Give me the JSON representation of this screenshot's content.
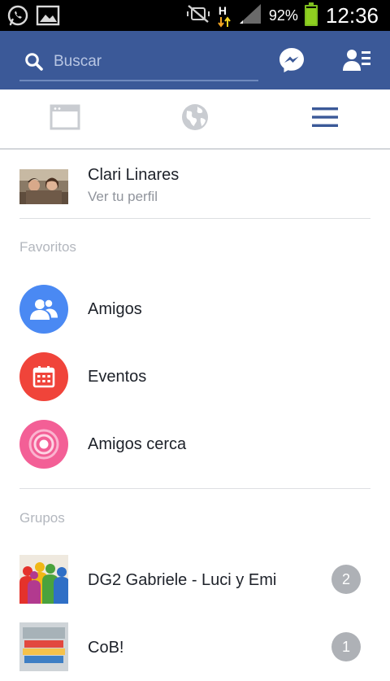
{
  "status_bar": {
    "battery_percent": "92%",
    "battery_level": 0.92,
    "time": "12:36",
    "network_type": "H",
    "icons": [
      "whatsapp-icon",
      "gallery-icon",
      "mute-icon",
      "data-arrows-icon",
      "signal-icon",
      "battery-icon"
    ]
  },
  "header": {
    "search_placeholder": "Buscar",
    "icons": [
      "search-icon",
      "messenger-icon",
      "friend-requests-icon"
    ]
  },
  "tabs": [
    {
      "name": "news-feed",
      "icon": "news-feed-icon",
      "active": false
    },
    {
      "name": "notifications",
      "icon": "globe-icon",
      "active": false
    },
    {
      "name": "more",
      "icon": "hamburger-menu-icon",
      "active": true
    }
  ],
  "profile": {
    "name": "Clari Linares",
    "subtitle": "Ver tu perfil"
  },
  "favorites": {
    "title": "Favoritos",
    "items": [
      {
        "label": "Amigos",
        "icon": "friends-icon",
        "color": "#4a89f3"
      },
      {
        "label": "Eventos",
        "icon": "calendar-icon",
        "color": "#f0443a"
      },
      {
        "label": "Amigos cerca",
        "icon": "nearby-friends-icon",
        "color": "#f35f96"
      }
    ]
  },
  "groups": {
    "title": "Grupos",
    "items": [
      {
        "label": "DG2 Gabriele - Luci y Emi",
        "badge": "2"
      },
      {
        "label": "CoB!",
        "badge": "1"
      }
    ]
  },
  "colors": {
    "brand": "#3b5998",
    "badge": "#aeb1b6",
    "active_tab": "#3b5998",
    "inactive_tab": "#c9ccd1"
  }
}
